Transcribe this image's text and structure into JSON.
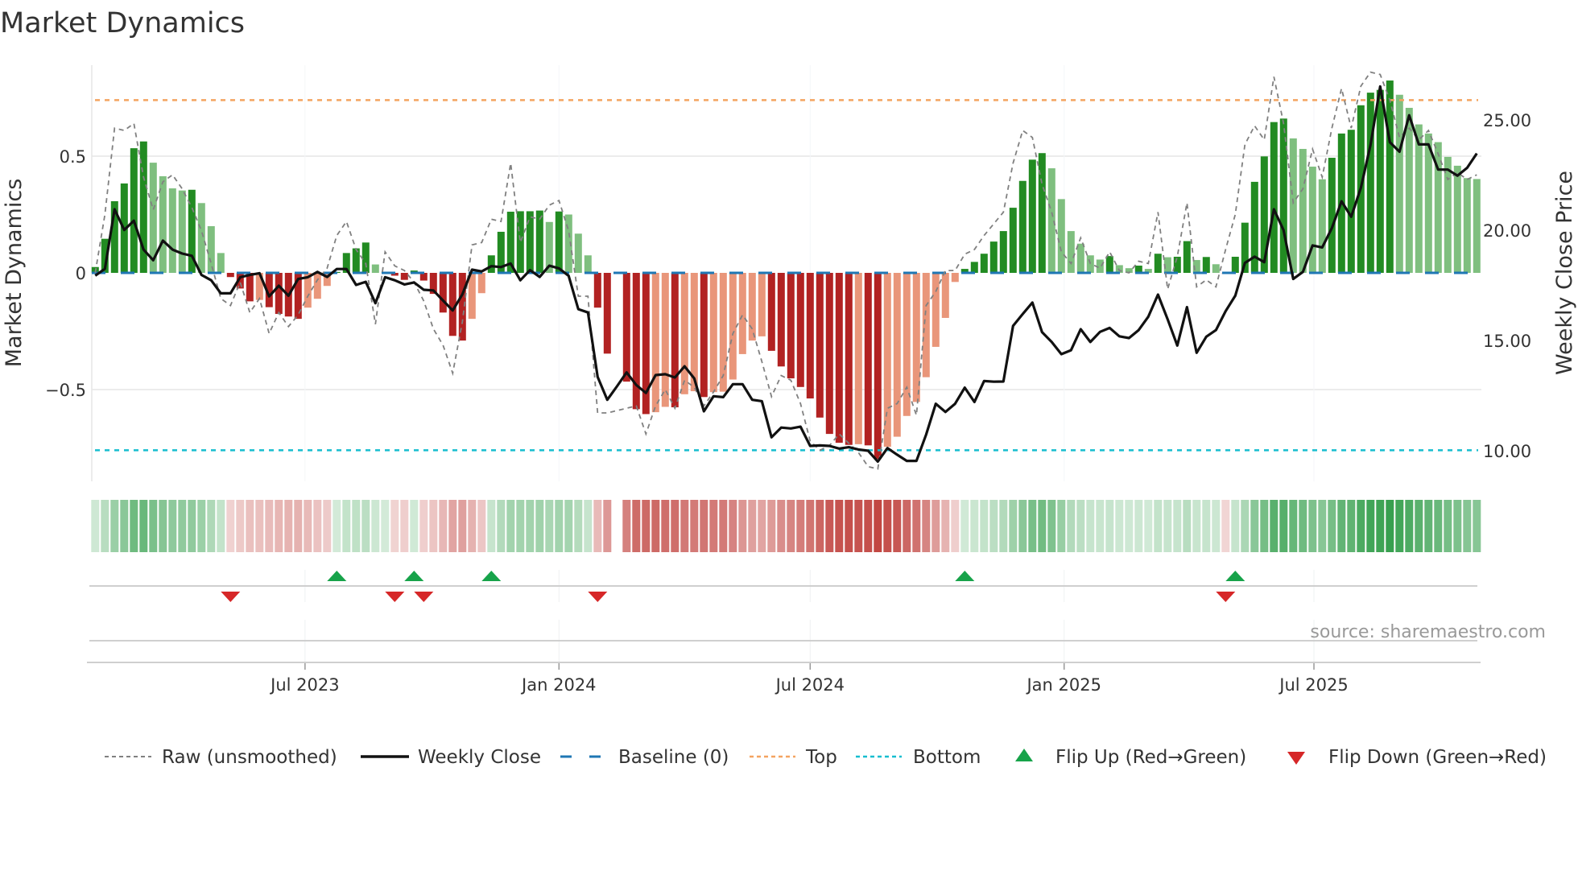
{
  "title": "Market Dynamics",
  "source": "source: sharemaestro.com",
  "colors": {
    "strong_up": "#228b22",
    "weak_up": "#7fbf7f",
    "strong_down": "#b22222",
    "weak_down": "#e9967a",
    "raw": "#808080",
    "close": "#111111",
    "baseline": "#1f77b4",
    "top": "#f4a460",
    "bottom": "#17becf",
    "flip_up": "#17a34a",
    "flip_down": "#d62728"
  },
  "legend": [
    {
      "label": "Raw (unsmoothed)",
      "icon": "dashed-gray-line"
    },
    {
      "label": "Weekly Close",
      "icon": "solid-black-line"
    },
    {
      "label": "Baseline (0)",
      "icon": "dashed-blue-line"
    },
    {
      "label": "Top",
      "icon": "dotted-orange-line"
    },
    {
      "label": "Bottom",
      "icon": "dotted-cyan-line"
    },
    {
      "label": "Flip Up (Red→Green)",
      "icon": "triangle-up-icon"
    },
    {
      "label": "Flip Down (Green→Red)",
      "icon": "triangle-down-icon"
    }
  ],
  "chart_data": {
    "type": "bar",
    "title": "Market Dynamics",
    "ylabel": "Market Dynamics",
    "y2label": "Weekly Close Price",
    "start_date": "2023-01-30",
    "frequency": "weekly",
    "ylim": [
      -0.9,
      0.93
    ],
    "y2lim": [
      8.6,
      27.5
    ],
    "y_ticks": [
      {
        "value": 0.5,
        "label": "0.5"
      },
      {
        "value": 0,
        "label": "0"
      },
      {
        "value": -0.5,
        "label": "−0.5"
      }
    ],
    "y2_ticks": [
      {
        "value": 25,
        "label": "25.00"
      },
      {
        "value": 20,
        "label": "20.00"
      },
      {
        "value": 15,
        "label": "15.00"
      },
      {
        "value": 10,
        "label": "10.00"
      }
    ],
    "x_ticks": [
      {
        "date": "2023-07-01",
        "label": "Jul 2023"
      },
      {
        "date": "2024-01-01",
        "label": "Jan 2024"
      },
      {
        "date": "2024-07-01",
        "label": "Jul 2024"
      },
      {
        "date": "2025-01-01",
        "label": "Jan 2025"
      },
      {
        "date": "2025-07-01",
        "label": "Jul 2025"
      }
    ],
    "top_level": 0.74,
    "bottom_level": -0.76,
    "baseline": 0,
    "grid": true,
    "legend_position": "bottom",
    "values": [
      0.025,
      0.146,
      0.307,
      0.383,
      0.534,
      0.563,
      0.472,
      0.414,
      0.362,
      0.353,
      0.356,
      0.299,
      0.2,
      0.085,
      -0.018,
      -0.067,
      -0.122,
      -0.116,
      -0.147,
      -0.176,
      -0.187,
      -0.197,
      -0.149,
      -0.111,
      -0.056,
      0.004,
      0.085,
      0.105,
      0.13,
      0.036,
      0.005,
      -0.012,
      -0.03,
      0.01,
      -0.033,
      -0.09,
      -0.17,
      -0.27,
      -0.29,
      -0.197,
      -0.087,
      0.075,
      0.176,
      0.262,
      0.264,
      0.264,
      0.267,
      0.218,
      0.263,
      0.25,
      0.168,
      0.075,
      -0.149,
      -0.346,
      null,
      -0.466,
      -0.584,
      -0.605,
      -0.597,
      -0.574,
      -0.576,
      -0.52,
      -0.507,
      -0.532,
      -0.511,
      -0.509,
      -0.457,
      -0.348,
      -0.29,
      -0.272,
      -0.334,
      -0.401,
      -0.452,
      -0.489,
      -0.538,
      -0.62,
      -0.69,
      -0.728,
      -0.737,
      -0.734,
      -0.739,
      -0.797,
      -0.745,
      -0.702,
      -0.613,
      -0.553,
      -0.447,
      -0.317,
      -0.193,
      -0.039,
      0.017,
      0.047,
      0.082,
      0.134,
      0.179,
      0.279,
      0.394,
      0.485,
      0.513,
      0.448,
      0.316,
      0.179,
      0.125,
      0.075,
      0.057,
      0.072,
      0.033,
      0.02,
      0.031,
      0.017,
      0.082,
      0.067,
      0.069,
      0.136,
      0.055,
      0.068,
      0.037,
      -0.005,
      0.069,
      0.215,
      0.39,
      0.499,
      0.646,
      0.661,
      0.576,
      0.531,
      0.455,
      0.401,
      0.493,
      0.597,
      0.613,
      0.718,
      0.772,
      0.784,
      0.824,
      0.763,
      0.707,
      0.636,
      0.597,
      0.56,
      0.497,
      0.459,
      0.406,
      0.402
    ],
    "strong": [
      1,
      1,
      1,
      1,
      1,
      1,
      0,
      0,
      0,
      0,
      1,
      0,
      0,
      0,
      1,
      1,
      1,
      0,
      1,
      1,
      1,
      1,
      0,
      0,
      0,
      1,
      1,
      1,
      1,
      0,
      0,
      1,
      1,
      1,
      1,
      1,
      1,
      1,
      1,
      0,
      0,
      1,
      1,
      1,
      1,
      1,
      1,
      0,
      1,
      0,
      0,
      0,
      1,
      1,
      0,
      1,
      1,
      1,
      0,
      0,
      1,
      0,
      0,
      1,
      0,
      0,
      0,
      0,
      0,
      0,
      1,
      1,
      1,
      1,
      1,
      1,
      1,
      1,
      1,
      0,
      1,
      1,
      0,
      0,
      0,
      0,
      0,
      0,
      0,
      0,
      1,
      1,
      1,
      1,
      1,
      1,
      1,
      1,
      1,
      0,
      0,
      0,
      0,
      0,
      0,
      1,
      0,
      0,
      1,
      0,
      1,
      0,
      1,
      1,
      0,
      1,
      0,
      1,
      1,
      1,
      1,
      1,
      1,
      1,
      0,
      0,
      0,
      0,
      1,
      1,
      1,
      1,
      1,
      1,
      1,
      0,
      0,
      0,
      0,
      0,
      0,
      0,
      0,
      0
    ],
    "raw": [
      0.0,
      0.25,
      0.62,
      0.61,
      0.64,
      0.41,
      0.27,
      0.39,
      0.42,
      0.36,
      0.28,
      0.18,
      0.04,
      -0.11,
      -0.14,
      -0.04,
      -0.17,
      -0.11,
      -0.26,
      -0.17,
      -0.23,
      -0.18,
      -0.1,
      -0.03,
      0.02,
      0.16,
      0.22,
      0.1,
      0.04,
      -0.22,
      0.09,
      0.03,
      0.01,
      -0.04,
      -0.12,
      -0.24,
      -0.31,
      -0.43,
      -0.21,
      0.12,
      0.13,
      0.23,
      0.22,
      0.47,
      0.13,
      0.24,
      0.23,
      0.29,
      0.31,
      0.18,
      -0.1,
      -0.1,
      -0.6,
      -0.6,
      -0.59,
      -0.58,
      -0.57,
      -0.69,
      -0.57,
      -0.5,
      -0.58,
      -0.46,
      -0.49,
      -0.57,
      -0.51,
      -0.44,
      -0.26,
      -0.18,
      -0.24,
      -0.38,
      -0.53,
      -0.44,
      -0.46,
      -0.56,
      -0.72,
      -0.76,
      -0.74,
      -0.69,
      -0.73,
      -0.77,
      -0.83,
      -0.84,
      -0.58,
      -0.56,
      -0.49,
      -0.61,
      -0.14,
      -0.08,
      0.01,
      0.01,
      0.08,
      0.1,
      0.16,
      0.21,
      0.26,
      0.47,
      0.61,
      0.58,
      0.38,
      0.26,
      0.09,
      0.04,
      0.15,
      0.04,
      0.02,
      0.09,
      0.01,
      0.0,
      0.05,
      0.04,
      0.26,
      -0.07,
      0.07,
      0.3,
      -0.06,
      -0.03,
      -0.06,
      0.1,
      0.25,
      0.55,
      0.63,
      0.57,
      0.84,
      0.64,
      0.3,
      0.36,
      0.53,
      0.41,
      0.62,
      0.79,
      0.62,
      0.8,
      0.86,
      0.85,
      0.74,
      0.58,
      0.62,
      0.57,
      0.61,
      0.51,
      0.4,
      0.43,
      0.4,
      0.42
    ],
    "close": [
      17.94,
      18.25,
      20.95,
      20.01,
      20.43,
      19.12,
      18.64,
      19.53,
      19.12,
      18.94,
      18.84,
      17.97,
      17.73,
      17.14,
      17.14,
      17.87,
      17.97,
      18.05,
      17.0,
      17.48,
      17.03,
      17.79,
      17.87,
      18.11,
      17.88,
      18.24,
      18.24,
      17.52,
      17.66,
      16.69,
      17.87,
      17.73,
      17.54,
      17.63,
      17.3,
      17.27,
      16.81,
      16.36,
      17.09,
      18.21,
      18.13,
      18.37,
      18.33,
      18.49,
      17.73,
      18.19,
      17.88,
      18.39,
      18.27,
      17.93,
      16.42,
      16.27,
      13.35,
      12.31,
      12.92,
      13.55,
      12.98,
      12.62,
      13.43,
      13.47,
      13.32,
      13.83,
      13.28,
      11.79,
      12.47,
      12.43,
      13.02,
      13.02,
      12.31,
      12.25,
      10.61,
      11.05,
      11.01,
      11.09,
      10.22,
      10.24,
      10.22,
      10.1,
      10.16,
      10.06,
      10.0,
      9.51,
      10.12,
      9.82,
      9.54,
      9.54,
      10.73,
      12.13,
      11.76,
      12.13,
      12.86,
      12.21,
      13.16,
      13.13,
      13.14,
      15.66,
      16.2,
      16.72,
      15.38,
      14.93,
      14.38,
      14.56,
      15.51,
      14.93,
      15.39,
      15.57,
      15.19,
      15.11,
      15.47,
      16.08,
      17.08,
      15.96,
      14.77,
      16.51,
      14.44,
      15.17,
      15.47,
      16.33,
      17.03,
      18.52,
      18.8,
      18.55,
      20.95,
      20.0,
      17.79,
      18.11,
      19.31,
      19.22,
      20.1,
      21.31,
      20.61,
      21.92,
      23.87,
      26.52,
      23.99,
      23.56,
      25.21,
      23.89,
      23.89,
      22.75,
      22.75,
      22.47,
      22.83,
      23.48
    ],
    "flip_up_dates": [
      "2023-07-24",
      "2023-09-18",
      "2023-11-13",
      "2024-10-21",
      "2025-05-05"
    ],
    "flip_down_dates": [
      "2023-05-08",
      "2023-09-04",
      "2023-09-25",
      "2024-01-29",
      "2025-04-28"
    ]
  }
}
